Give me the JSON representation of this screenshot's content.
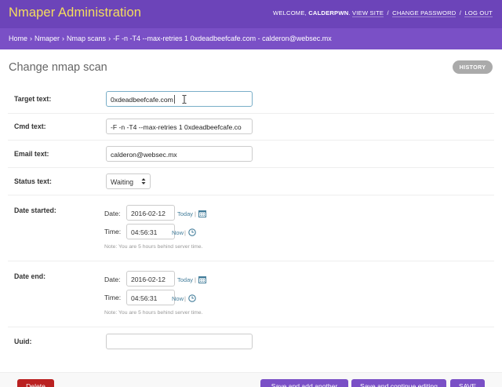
{
  "header": {
    "brand": "Nmaper Administration",
    "welcome_prefix": "WELCOME, ",
    "username": "CALDERPWN",
    "welcome_suffix": ".",
    "view_site": "VIEW SITE",
    "change_password": "CHANGE PASSWORD",
    "log_out": "LOG OUT",
    "separator": "/"
  },
  "breadcrumbs": {
    "items": [
      "Home",
      "Nmaper",
      "Nmap scans",
      "-F -n -T4 --max-retries 1 0xdeadbeefcafe.com - calderon@websec.mx"
    ],
    "arrow": "›"
  },
  "page": {
    "title": "Change nmap scan",
    "history_label": "HISTORY"
  },
  "form": {
    "target": {
      "label": "Target text:",
      "value": "0xdeadbeefcafe.com"
    },
    "cmd": {
      "label": "Cmd text:",
      "value": "-F -n -T4 --max-retries 1 0xdeadbeefcafe.co"
    },
    "email": {
      "label": "Email text:",
      "value": "calderon@websec.mx"
    },
    "status": {
      "label": "Status text:",
      "value": "Waiting",
      "arrows": "▲▼"
    },
    "date_started": {
      "label": "Date started:",
      "date_label": "Date:",
      "date_value": "2016-02-12",
      "today_link": "Today",
      "time_label": "Time:",
      "time_value": "04:56:31",
      "now_link": "Now",
      "note": "Note: You are 5 hours behind server time."
    },
    "date_end": {
      "label": "Date end:",
      "date_label": "Date:",
      "date_value": "2016-02-12",
      "today_link": "Today",
      "time_label": "Time:",
      "time_value": "04:56:31",
      "now_link": "Now",
      "note": "Note: You are 5 hours behind server time."
    },
    "uuid": {
      "label": "Uuid:",
      "value": ""
    },
    "shortcut_separator": "|"
  },
  "submit": {
    "delete_label": "Delete",
    "save_add_label": "Save and add another",
    "save_continue_label": "Save and continue editing",
    "save_label": "SAVE"
  },
  "colors": {
    "header_bg": "#6c44b9",
    "breadcrumb_bg": "#7a50c6",
    "brand_text": "#f5dd5d",
    "link": "#447e9b",
    "delete_bg": "#ba2121"
  },
  "icons": [
    "calendar-icon",
    "clock-icon",
    "chevron-up-down-icon",
    "text-cursor-icon"
  ]
}
